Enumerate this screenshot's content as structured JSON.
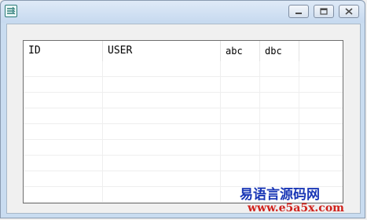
{
  "window": {
    "title": "",
    "icon": "app-icon",
    "controls": {
      "minimize": "minimize-icon",
      "maximize": "maximize-icon",
      "close": "close-icon"
    }
  },
  "listview": {
    "columns": [
      "ID",
      "USER",
      "abc",
      "dbc",
      ""
    ],
    "rows": []
  },
  "watermark": {
    "line1": "易语言源码网",
    "line2": "www.e5a5x.com"
  },
  "colors": {
    "titlebar": "#c6d9ef",
    "client": "#f0f0f0",
    "watermark_blue": "#1a37b6",
    "watermark_red": "#d0211b"
  }
}
